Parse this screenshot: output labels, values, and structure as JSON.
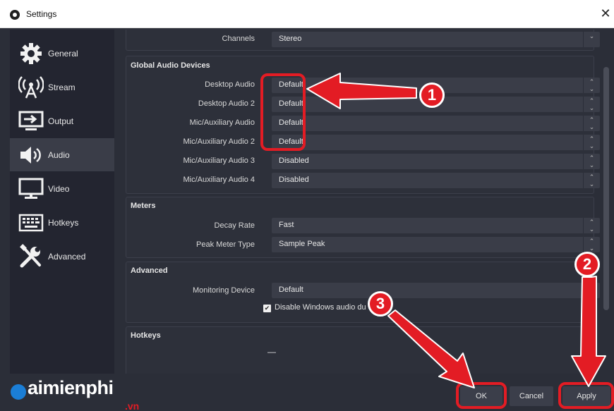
{
  "window": {
    "title": "Settings",
    "close_glyph": "✕"
  },
  "sidebar": {
    "items": [
      {
        "label": "General",
        "icon": "gear-icon"
      },
      {
        "label": "Stream",
        "icon": "broadcast-icon"
      },
      {
        "label": "Output",
        "icon": "output-icon"
      },
      {
        "label": "Audio",
        "icon": "speaker-icon"
      },
      {
        "label": "Video",
        "icon": "monitor-icon"
      },
      {
        "label": "Hotkeys",
        "icon": "keyboard-icon"
      },
      {
        "label": "Advanced",
        "icon": "wrench-screwdriver-icon"
      }
    ],
    "active": "Audio"
  },
  "top_row": {
    "label": "Channels",
    "value": "Stereo"
  },
  "global_audio": {
    "title": "Global Audio Devices",
    "rows": [
      {
        "label": "Desktop Audio",
        "value": "Default"
      },
      {
        "label": "Desktop Audio 2",
        "value": "Default"
      },
      {
        "label": "Mic/Auxiliary Audio",
        "value": "Default"
      },
      {
        "label": "Mic/Auxiliary Audio 2",
        "value": "Default"
      },
      {
        "label": "Mic/Auxiliary Audio 3",
        "value": "Disabled"
      },
      {
        "label": "Mic/Auxiliary Audio 4",
        "value": "Disabled"
      }
    ]
  },
  "meters": {
    "title": "Meters",
    "rows": [
      {
        "label": "Decay Rate",
        "value": "Fast"
      },
      {
        "label": "Peak Meter Type",
        "value": "Sample Peak"
      }
    ]
  },
  "advanced": {
    "title": "Advanced",
    "monitoring_label": "Monitoring Device",
    "monitoring_value": "Default",
    "checkbox_label": "Disable Windows audio du",
    "checkbox_checked": true
  },
  "hotkeys": {
    "title": "Hotkeys",
    "value": "—"
  },
  "buttons": {
    "ok": "OK",
    "cancel": "Cancel",
    "apply": "Apply"
  },
  "annotations": {
    "one": "1",
    "two": "2",
    "three": "3",
    "highlight_color": "#e31c24"
  },
  "watermark": {
    "main": "aimienphi",
    "suffix": ".vn"
  }
}
